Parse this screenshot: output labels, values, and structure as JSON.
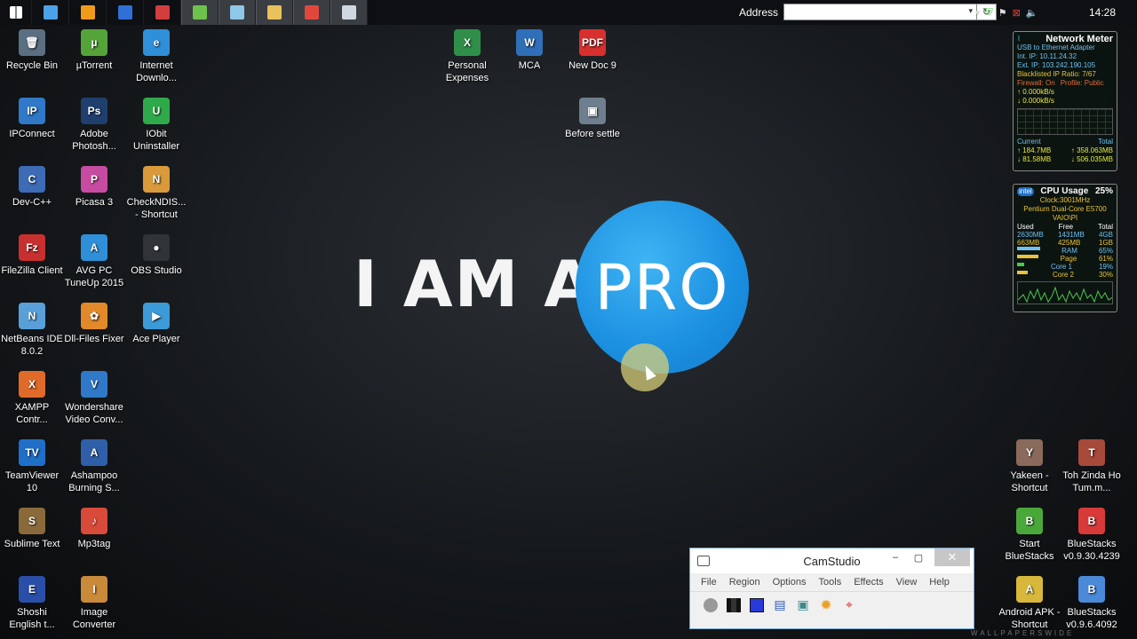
{
  "taskbar": {
    "address_label": "Address",
    "address_value": "",
    "clock": "14:28",
    "buttons": [
      {
        "name": "start-icon",
        "color": "#ffffff"
      },
      {
        "name": "computer-icon",
        "color": "#4aa3e8"
      },
      {
        "name": "media-player-icon",
        "color": "#f09a1a"
      },
      {
        "name": "app-icon",
        "color": "#2f6fd8"
      },
      {
        "name": "app-icon-2",
        "color": "#d33d3d"
      },
      {
        "name": "app-icon-3",
        "color": "#6cc24a"
      },
      {
        "name": "notepad-icon",
        "color": "#8fc7e8"
      },
      {
        "name": "file-explorer-icon",
        "color": "#e8c25a"
      },
      {
        "name": "chrome-icon",
        "color": "#e0483c"
      },
      {
        "name": "camstudio-icon",
        "color": "#cfd8e0"
      }
    ]
  },
  "desktop_icons": [
    {
      "label": "Recycle Bin",
      "color": "#5a6f82",
      "glyph": "🗑"
    },
    {
      "label": "µTorrent",
      "color": "#55a43a",
      "glyph": "µ"
    },
    {
      "label": "Internet Downlo...",
      "color": "#2f8fd8",
      "glyph": "e"
    },
    {
      "label": "IPConnect",
      "color": "#2f79c8",
      "glyph": "IP"
    },
    {
      "label": "Adobe Photosh...",
      "color": "#1f3f6f",
      "glyph": "Ps"
    },
    {
      "label": "IObit Uninstaller",
      "color": "#2faa4a",
      "glyph": "U"
    },
    {
      "label": "Dev-C++",
      "color": "#3d6bb5",
      "glyph": "C"
    },
    {
      "label": "Picasa 3",
      "color": "#c74ba0",
      "glyph": "P"
    },
    {
      "label": "CheckNDIS... - Shortcut",
      "color": "#d89a3a",
      "glyph": "N"
    },
    {
      "label": "FileZilla Client",
      "color": "#c8302f",
      "glyph": "Fz"
    },
    {
      "label": "AVG PC TuneUp 2015",
      "color": "#2f8fd8",
      "glyph": "A"
    },
    {
      "label": "OBS Studio",
      "color": "#303439",
      "glyph": "●"
    },
    {
      "label": "NetBeans IDE 8.0.2",
      "color": "#5aa0d8",
      "glyph": "N"
    },
    {
      "label": "Dll-Files Fixer",
      "color": "#e28a2a",
      "glyph": "✿"
    },
    {
      "label": "Ace Player",
      "color": "#3d9ad8",
      "glyph": "▶"
    },
    {
      "label": "XAMPP Contr...",
      "color": "#e06a2a",
      "glyph": "X"
    },
    {
      "label": "Wondershare Video Conv...",
      "color": "#2f79c8",
      "glyph": "V"
    },
    {
      "label": "TeamViewer 10",
      "color": "#1f6fc8",
      "glyph": "TV"
    },
    {
      "label": "Ashampoo Burning S...",
      "color": "#2f5fa8",
      "glyph": "A"
    },
    {
      "label": "Sublime Text",
      "color": "#8a6a3a",
      "glyph": "S"
    },
    {
      "label": "Mp3tag",
      "color": "#d84a3a",
      "glyph": "♪"
    },
    {
      "label": "Shoshi English t...",
      "color": "#2a4fa8",
      "glyph": "E"
    },
    {
      "label": "Image Converter",
      "color": "#c98a3a",
      "glyph": "I"
    },
    {
      "label": "Personal Expenses",
      "color": "#2f8f4a",
      "glyph": "X"
    },
    {
      "label": "MCA",
      "color": "#2f6fb8",
      "glyph": "W"
    },
    {
      "label": "New Doc 9",
      "color": "#d82f2f",
      "glyph": "PDF"
    },
    {
      "label": "Before settle",
      "color": "#6f7f8f",
      "glyph": "▣"
    },
    {
      "label": "Yakeen - Shortcut",
      "color": "#8a6a5a",
      "glyph": "Y"
    },
    {
      "label": "Toh Zinda Ho Tum.m...",
      "color": "#a84a3a",
      "glyph": "T"
    },
    {
      "label": "Start BlueStacks",
      "color": "#4aa83a",
      "glyph": "B"
    },
    {
      "label": "BlueStacks v0.9.30.4239",
      "color": "#d83a3a",
      "glyph": "B"
    },
    {
      "label": "Android APK - Shortcut",
      "color": "#d8b83a",
      "glyph": "A"
    },
    {
      "label": "BlueStacks v0.9.6.4092",
      "color": "#4a8ad8",
      "glyph": "B"
    }
  ],
  "wallpaper": {
    "text": "I AM A",
    "circle_text": "PRO"
  },
  "network_meter": {
    "title": "Network Meter",
    "adapter": "USB to Ethernet Adapter",
    "int_ip": "Int. IP: 10.11.24.32",
    "ext_ip": "Ext. IP: 103.242.190.105",
    "blacklist": "Blacklisted IP Ratio: 7/67",
    "firewall": "Firewall: On",
    "profile": "Profile: Public",
    "up": "0.000kB/s",
    "down": "0.000kB/s",
    "current_label": "Current",
    "total_label": "Total",
    "cur_up": "184.7MB",
    "cur_down": "81.58MB",
    "tot_up": "358.063MB",
    "tot_down": "506.035MB"
  },
  "cpu": {
    "title": "CPU Usage",
    "percent": "25%",
    "clock": "Clock:3001MHz",
    "model": "Pentium Dual-Core E5700",
    "host": "VAIO\\PI",
    "headers": [
      "Used",
      "Free",
      "Total"
    ],
    "row1": [
      "2630MB",
      "1431MB",
      "4GB"
    ],
    "row2": [
      "663MB",
      "425MB",
      "1GB"
    ],
    "ram": "RAM",
    "ram_pct": "65%",
    "ram_fill": 0.65,
    "page": "Page",
    "page_pct": "61%",
    "page_fill": 0.61,
    "core1": "Core 1",
    "core1_pct": "19%",
    "core1_fill": 0.19,
    "core2": "Core 2",
    "core2_pct": "30%",
    "core2_fill": 0.3
  },
  "camstudio": {
    "title": "CamStudio",
    "menu": [
      "File",
      "Region",
      "Options",
      "Tools",
      "Effects",
      "View",
      "Help"
    ],
    "minimize": "–",
    "maximize": "▢",
    "close": "✕"
  }
}
